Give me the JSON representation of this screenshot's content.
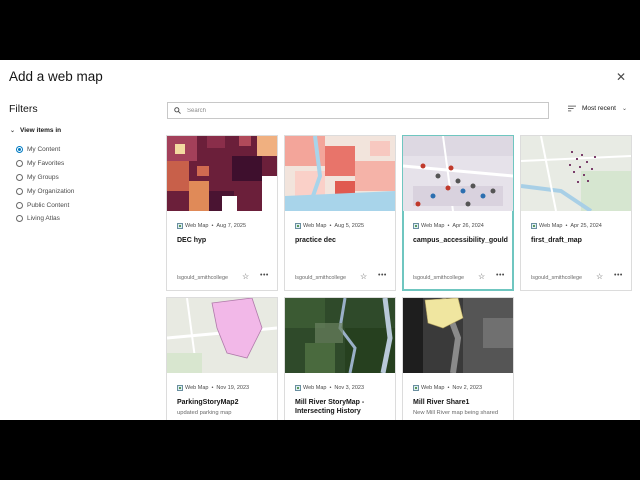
{
  "dialog": {
    "title": "Add a web map",
    "close_glyph": "✕"
  },
  "filters": {
    "title": "Filters",
    "group_label": "View items in",
    "options": [
      {
        "label": "My Content",
        "selected": true
      },
      {
        "label": "My Favorites",
        "selected": false
      },
      {
        "label": "My Groups",
        "selected": false
      },
      {
        "label": "My Organization",
        "selected": false
      },
      {
        "label": "Public Content",
        "selected": false
      },
      {
        "label": "Living Atlas",
        "selected": false
      }
    ]
  },
  "search": {
    "placeholder": "Search",
    "value": ""
  },
  "sort": {
    "label": "Most recent"
  },
  "cards": [
    {
      "type": "Web Map",
      "date": "Aug 7, 2025",
      "title": "DEC hyp",
      "desc": "",
      "owner": "lsgould_smithcollege"
    },
    {
      "type": "Web Map",
      "date": "Aug 5, 2025",
      "title": "practice dec",
      "desc": "",
      "owner": "lsgould_smithcollege"
    },
    {
      "type": "Web Map",
      "date": "Apr 26, 2024",
      "title": "campus_accessibility_gould",
      "desc": "",
      "owner": "lsgould_smithcollege"
    },
    {
      "type": "Web Map",
      "date": "Apr 25, 2024",
      "title": "first_draft_map",
      "desc": "",
      "owner": "lsgould_smithcollege"
    },
    {
      "type": "Web Map",
      "date": "Nov 19, 2023",
      "title": "ParkingStoryMap2",
      "desc": "updated parking map",
      "owner": ""
    },
    {
      "type": "Web Map",
      "date": "Nov 3, 2023",
      "title": "Mill River StoryMap - Intersecting History",
      "desc": "",
      "owner": ""
    },
    {
      "type": "Web Map",
      "date": "Nov 2, 2023",
      "title": "Mill River Share1",
      "desc": "New Mill River map being shared",
      "owner": ""
    }
  ],
  "colors": {
    "accent": "#007ac2",
    "selected_border": "#6fc6c0"
  }
}
